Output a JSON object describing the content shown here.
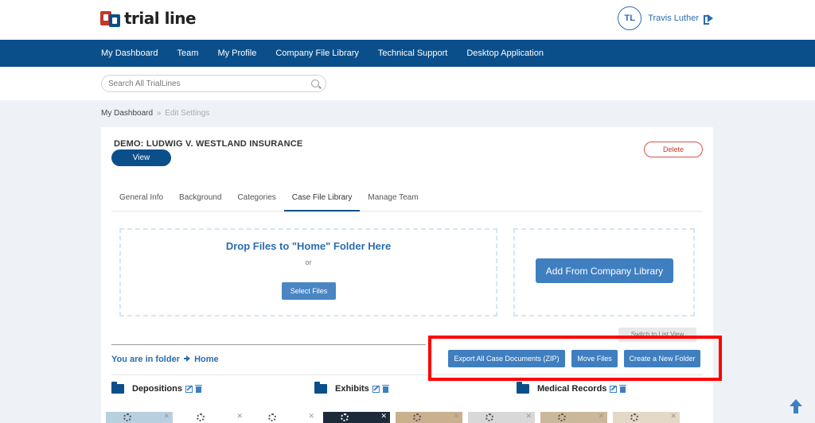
{
  "header": {
    "logo_text": "trial line",
    "user_initials": "TL",
    "user_name": "Travis Luther"
  },
  "nav": {
    "items": [
      "My Dashboard",
      "Team",
      "My Profile",
      "Company File Library",
      "Technical Support",
      "Desktop Application"
    ]
  },
  "search": {
    "placeholder": "Search All TrialLines",
    "value": ""
  },
  "breadcrumb": {
    "root": "My Dashboard",
    "separator": "»",
    "current": "Edit Settings"
  },
  "case": {
    "title": "DEMO: LUDWIG V. WESTLAND INSURANCE",
    "view_label": "View",
    "delete_label": "Delete"
  },
  "tabs": [
    {
      "label": "General Info",
      "active": false
    },
    {
      "label": "Background",
      "active": false
    },
    {
      "label": "Categories",
      "active": false
    },
    {
      "label": "Case File Library",
      "active": true
    },
    {
      "label": "Manage Team",
      "active": false
    }
  ],
  "dropzone": {
    "title": "Drop Files to \"Home\" Folder Here",
    "or": "or",
    "select_label": "Select Files"
  },
  "library": {
    "add_label": "Add From Company Library"
  },
  "switch_view_label": "Switch to List View",
  "folder_path": {
    "prefix": "You are in folder",
    "current": "Home"
  },
  "actions": {
    "export_label": "Export All Case Documents (ZIP)",
    "move_label": "Move Files",
    "create_label": "Create a New Folder"
  },
  "folders": [
    {
      "name": "Depositions"
    },
    {
      "name": "Exhibits"
    },
    {
      "name": "Medical Records"
    }
  ],
  "colors": {
    "brand_blue": "#0b4f8a",
    "accent_blue": "#3f7fc0",
    "highlight_red": "#ff0000"
  }
}
